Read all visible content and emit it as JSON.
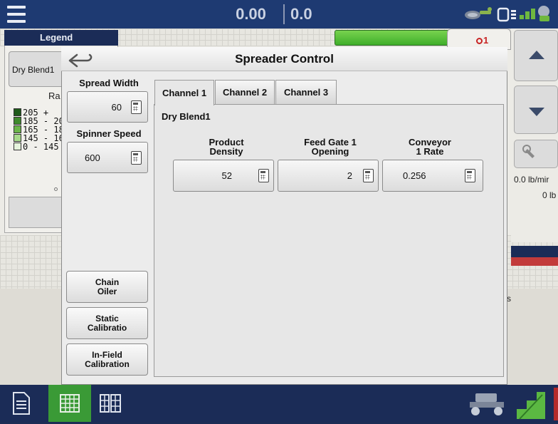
{
  "topbar": {
    "value_a": "0.00",
    "value_b": "0.0"
  },
  "legend": {
    "title": "Legend",
    "product": "Dry Blend1",
    "rate_label": "Ra",
    "rows": [
      {
        "label": "205 +",
        "color": "#1f5a1a"
      },
      {
        "label": "185 - 20",
        "color": "#3f8a2d"
      },
      {
        "label": "165 - 18",
        "color": "#6bb54a"
      },
      {
        "label": "145 - 16",
        "color": "#a6d98a"
      },
      {
        "label": "0 - 145",
        "color": "#e5f3dc"
      }
    ]
  },
  "right_panel": {
    "alert": "1",
    "rate": "0.0 lb/mir",
    "rate2": "0 lb",
    "fragment": "s"
  },
  "modal": {
    "title": "Spreader Control",
    "spread_width": {
      "label": "Spread Width",
      "value": "60"
    },
    "spinner_speed": {
      "label": "Spinner Speed",
      "value": "600"
    },
    "side_buttons": {
      "chain_oiler": "Chain\nOiler",
      "static_calibration": "Static\nCalibratio",
      "infield_calibration": "In-Field\nCalibration"
    },
    "tabs": [
      "Channel 1",
      "Channel 2",
      "Channel 3"
    ],
    "product": "Dry Blend1",
    "columns": {
      "product_density": {
        "label": "Product\nDensity",
        "value": "52"
      },
      "feed_gate": {
        "label": "Feed Gate 1\nOpening",
        "value": "2"
      },
      "conveyor_rate": {
        "label": "Conveyor\n1 Rate",
        "value": "0.256"
      }
    }
  },
  "colors": {
    "topbar": "#1e3a72",
    "bottombar": "#1b2c57",
    "accent_green": "#3a9a36",
    "alert_red": "#c82424"
  }
}
